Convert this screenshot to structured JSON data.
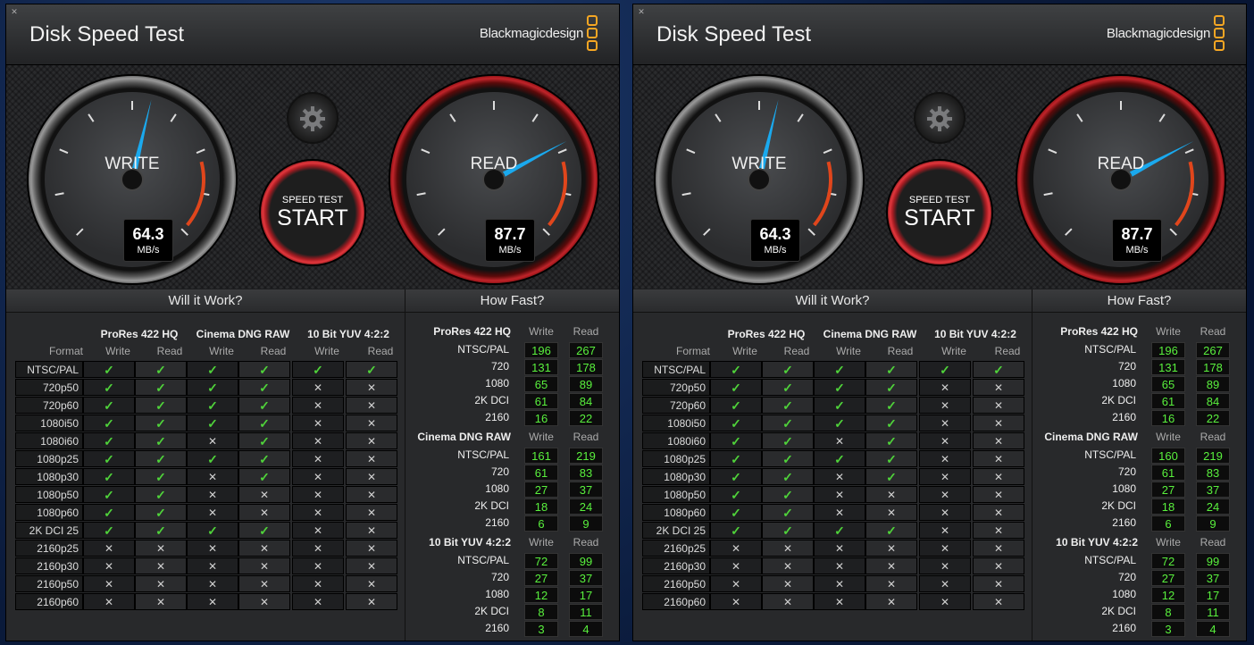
{
  "app_title": "Disk Speed Test",
  "brand": "Blackmagicdesign",
  "gauge_labels": {
    "write": "WRITE",
    "read": "READ",
    "unit": "MB/s"
  },
  "start_button": {
    "sub": "SPEED TEST",
    "main": "START"
  },
  "sections": {
    "will_it_work": "Will it Work?",
    "how_fast": "How Fast?"
  },
  "column_headers": {
    "format": "Format",
    "write": "Write",
    "read": "Read"
  },
  "codecs": [
    "ProRes 422 HQ",
    "Cinema DNG RAW",
    "10 Bit YUV 4:2:2"
  ],
  "formats": [
    "NTSC/PAL",
    "720p50",
    "720p60",
    "1080i50",
    "1080i60",
    "1080p25",
    "1080p30",
    "1080p50",
    "1080p60",
    "2K DCI 25",
    "2160p25",
    "2160p30",
    "2160p50",
    "2160p60"
  ],
  "compat": [
    [
      1,
      1,
      1,
      1,
      1,
      1
    ],
    [
      1,
      1,
      1,
      1,
      0,
      0
    ],
    [
      1,
      1,
      1,
      1,
      0,
      0
    ],
    [
      1,
      1,
      1,
      1,
      0,
      0
    ],
    [
      1,
      1,
      0,
      1,
      0,
      0
    ],
    [
      1,
      1,
      1,
      1,
      0,
      0
    ],
    [
      1,
      1,
      0,
      1,
      0,
      0
    ],
    [
      1,
      1,
      0,
      0,
      0,
      0
    ],
    [
      1,
      1,
      0,
      0,
      0,
      0
    ],
    [
      1,
      1,
      1,
      1,
      0,
      0
    ],
    [
      0,
      0,
      0,
      0,
      0,
      0
    ],
    [
      0,
      0,
      0,
      0,
      0,
      0
    ],
    [
      0,
      0,
      0,
      0,
      0,
      0
    ],
    [
      0,
      0,
      0,
      0,
      0,
      0
    ]
  ],
  "how_fast_rows": [
    "NTSC/PAL",
    "720",
    "1080",
    "2K DCI",
    "2160"
  ],
  "windows": [
    {
      "write_speed": "64.3",
      "read_speed": "87.7",
      "write_needle_fraction": 0.55,
      "read_needle_fraction": 0.73,
      "how_fast": [
        {
          "write": [
            "196",
            "131",
            "65",
            "61",
            "16"
          ],
          "read": [
            "267",
            "178",
            "89",
            "84",
            "22"
          ]
        },
        {
          "write": [
            "161",
            "61",
            "27",
            "18",
            "6"
          ],
          "read": [
            "219",
            "83",
            "37",
            "24",
            "9"
          ]
        },
        {
          "write": [
            "72",
            "27",
            "12",
            "8",
            "3"
          ],
          "read": [
            "99",
            "37",
            "17",
            "11",
            "4"
          ]
        }
      ]
    },
    {
      "write_speed": "64.3",
      "read_speed": "87.7",
      "write_needle_fraction": 0.55,
      "read_needle_fraction": 0.73,
      "how_fast": [
        {
          "write": [
            "196",
            "131",
            "65",
            "61",
            "16"
          ],
          "read": [
            "267",
            "178",
            "89",
            "84",
            "22"
          ]
        },
        {
          "write": [
            "160",
            "61",
            "27",
            "18",
            "6"
          ],
          "read": [
            "219",
            "83",
            "37",
            "24",
            "9"
          ]
        },
        {
          "write": [
            "72",
            "27",
            "12",
            "8",
            "3"
          ],
          "read": [
            "99",
            "37",
            "17",
            "11",
            "4"
          ]
        }
      ]
    }
  ],
  "colors": {
    "accent_green": "#59f03d",
    "needle": "#1aa9ee",
    "read_ring": "#c0242a",
    "logo": "#f5a623"
  }
}
